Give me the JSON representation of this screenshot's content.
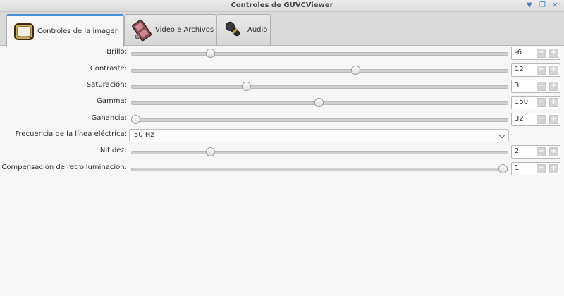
{
  "window": {
    "title": "Controles de GUVCViewer",
    "controls": [
      "chevron-down-icon",
      "restore-icon",
      "close-icon"
    ]
  },
  "tabs": [
    {
      "label": "Controles de la imagen",
      "icon": "tv-icon",
      "selected": true
    },
    {
      "label": "Video e Archivos",
      "icon": "film-icon",
      "selected": false
    },
    {
      "label": "Audio",
      "icon": "microphone-icon",
      "selected": false
    }
  ],
  "controls": {
    "brillo": {
      "label": "Brillo:",
      "value": "-6",
      "slider_fraction": 0.205
    },
    "contraste": {
      "label": "Contraste:",
      "value": "12",
      "slider_fraction": 0.6
    },
    "saturacion": {
      "label": "Saturación:",
      "value": "3",
      "slider_fraction": 0.302
    },
    "gamma": {
      "label": "Gamma:",
      "value": "150",
      "slider_fraction": 0.5
    },
    "ganancia": {
      "label": "Ganancia:",
      "value": "32",
      "slider_fraction": 0.0
    },
    "frecuencia": {
      "label": "Frecuencia de la línea eléctrica:",
      "value": "50 Hz"
    },
    "nitidez": {
      "label": "Nitidez:",
      "value": "2",
      "slider_fraction": 0.205
    },
    "retroiluminacion": {
      "label": "Compensación de retroiluminación:",
      "value": "1",
      "slider_fraction": 1.0
    }
  },
  "spin": {
    "minus": "−",
    "plus": "+"
  }
}
